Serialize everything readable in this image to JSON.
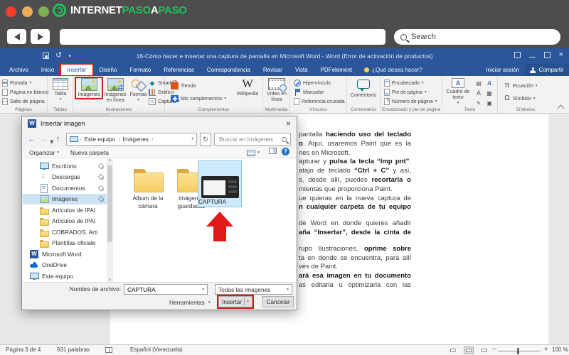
{
  "colors": {
    "brand_green": "#1fc05c",
    "word_blue": "#2b579a",
    "annotation_red": "#d41a1a",
    "selection_blue": "#cfe9fc",
    "folder_yellow": "#f4ce65"
  },
  "browser": {
    "logo_text_1": "INTERNET",
    "logo_text_2": "PASO",
    "logo_text_3": "A",
    "logo_text_4": "PASO",
    "search_placeholder": "Search"
  },
  "titlebar": {
    "title": "16-Cómo hacer e insertar una captura de pantalla en Microsoft Word - Word (Error de activación de productos)"
  },
  "tabs": {
    "items": [
      "Archivo",
      "Inicio",
      "Insertar",
      "Diseño",
      "Formato",
      "Referencias",
      "Correspondencia",
      "Revisar",
      "Vista",
      "PDFelement"
    ],
    "selected": "Insertar",
    "tell_me": "¿Qué desea hacer?",
    "sign_in": "Iniciar sesión",
    "share": "Compartir"
  },
  "ribbon": {
    "paginas": {
      "portada": "Portada",
      "pagina_en_blanco": "Página en blanco",
      "salto": "Salto de página",
      "label": "Páginas"
    },
    "tablas": {
      "tabla": "Tabla",
      "label": "Tablas"
    },
    "ilustraciones": {
      "imagenes": "Imágenes",
      "en_linea": "Imágenes en línea",
      "formas": "Formas",
      "smartart": "SmartArt",
      "grafico": "Gráfico",
      "captura": "Captura",
      "label": "Ilustraciones"
    },
    "complementos": {
      "tienda": "Tienda",
      "mis": "Mis complementos",
      "wikipedia": "Wikipedia",
      "label": "Complementos"
    },
    "multimedia": {
      "video": "Vídeo en línea",
      "label": "Multimedia"
    },
    "vinculos": {
      "hiper": "Hipervínculo",
      "marcador": "Marcador",
      "refcruz": "Referencia cruzada",
      "label": "Vínculos"
    },
    "comentarios": {
      "comentario": "Comentario",
      "label": "Comentarios"
    },
    "encabezado": {
      "enc": "Encabezado",
      "pie": "Pie de página",
      "num": "Número de página",
      "label": "Encabezado y pie de página"
    },
    "texto": {
      "cuadro": "Cuadro de texto",
      "label": "Texto"
    },
    "simbolos": {
      "ecuacion": "Ecuación",
      "simbolo": "Símbolo",
      "label": "Símbolos"
    }
  },
  "dialog": {
    "title": "Insertar imagen",
    "breadcrumb_root": "Este equipo",
    "breadcrumb_folder": "Imágenes",
    "search_placeholder": "Buscar en Imágenes",
    "organizar": "Organizar",
    "nueva_carpeta": "Nueva carpeta",
    "sidebar": [
      {
        "label": "Escritorio",
        "icon": "desktop",
        "pinned": true
      },
      {
        "label": "Descargas",
        "icon": "download",
        "pinned": true
      },
      {
        "label": "Documentos",
        "icon": "document",
        "pinned": true
      },
      {
        "label": "Imágenes",
        "icon": "pictures",
        "pinned": true,
        "selected": true
      },
      {
        "label": "Artículos de IPAI",
        "icon": "folder"
      },
      {
        "label": "Artículos de IPAI",
        "icon": "folder"
      },
      {
        "label": "COBRADOS. Arti",
        "icon": "folder"
      },
      {
        "label": "Plantillas oficiale",
        "icon": "folder"
      },
      {
        "label": "Microsoft Word",
        "icon": "word",
        "section": true
      },
      {
        "label": "OneDrive",
        "icon": "onedrive",
        "section": true
      },
      {
        "label": "Este equipo",
        "icon": "computer",
        "section": true
      }
    ],
    "files": [
      {
        "label": "Álbum de la cámara"
      },
      {
        "label": "Imágenes guardadas"
      }
    ],
    "selected_file": "CAPTURA",
    "filename_label": "Nombre de archivo:",
    "filename_value": "CAPTURA",
    "filetype": "Todas las imágenes",
    "herramientas": "Herramientas",
    "insertar": "Insertar",
    "cancelar": "Cancelar"
  },
  "document": {
    "lines": [
      {
        "just": true,
        "segs": [
          {
            "t": "pantalla "
          },
          {
            "t": "haciendo uso del teclado",
            "b": true
          }
        ]
      },
      {
        "just": true,
        "segs": [
          {
            "t": "o",
            "b": true
          },
          {
            "t": ". Aquí, usaremos Paint que es la"
          }
        ]
      },
      {
        "just": false,
        "segs": [
          {
            "t": "nes en Microsoft."
          }
        ]
      },
      {
        "just": true,
        "segs": [
          {
            "t": "apturar y "
          },
          {
            "t": "pulsa la tecla “Imp pnt”",
            "b": true
          },
          {
            "t": "."
          }
        ]
      },
      {
        "just": true,
        "segs": [
          {
            "t": "atajo de teclado "
          },
          {
            "t": "“Ctrl + C”",
            "b": true
          },
          {
            "t": " y así,"
          }
        ]
      },
      {
        "just": true,
        "segs": [
          {
            "t": "s, desde allí, puedes "
          },
          {
            "t": "recortarla o",
            "b": true
          }
        ]
      },
      {
        "just": false,
        "segs": [
          {
            "t": "mientas que proporciona Paint."
          }
        ]
      },
      {
        "just": true,
        "segs": [
          {
            "t": "ue quieras en la nueva captura de"
          }
        ]
      },
      {
        "just": true,
        "gap": true,
        "segs": [
          {
            "t": "n cualquier carpeta de tu equipo",
            "b": true
          }
        ]
      },
      {
        "just": true,
        "segs": [
          {
            "t": "de Word en donde quieres añadir"
          }
        ]
      },
      {
        "just": true,
        "gap": true,
        "segs": [
          {
            "t": "aña “Insertar”, desde la cinta de",
            "b": true
          }
        ]
      },
      {
        "just": true,
        "segs": [
          {
            "t": "rupo Ilustraciones, "
          },
          {
            "t": "oprime sobre",
            "b": true
          }
        ]
      },
      {
        "just": true,
        "segs": [
          {
            "t": "ta en donde se encuentra, para allí"
          }
        ]
      },
      {
        "just": false,
        "segs": [
          {
            "t": "vés de Paint."
          }
        ]
      },
      {
        "just": true,
        "segs": [
          {
            "t": "ará esa imagen en tu documento",
            "b": true
          }
        ]
      },
      {
        "just": true,
        "segs": [
          {
            "t": "as editarla u optimizarla con las"
          }
        ]
      }
    ]
  },
  "statusbar": {
    "page": "Página 3 de 4",
    "words": "931 palabras",
    "language": "Español (Venezuela)",
    "zoom": "100 %"
  }
}
